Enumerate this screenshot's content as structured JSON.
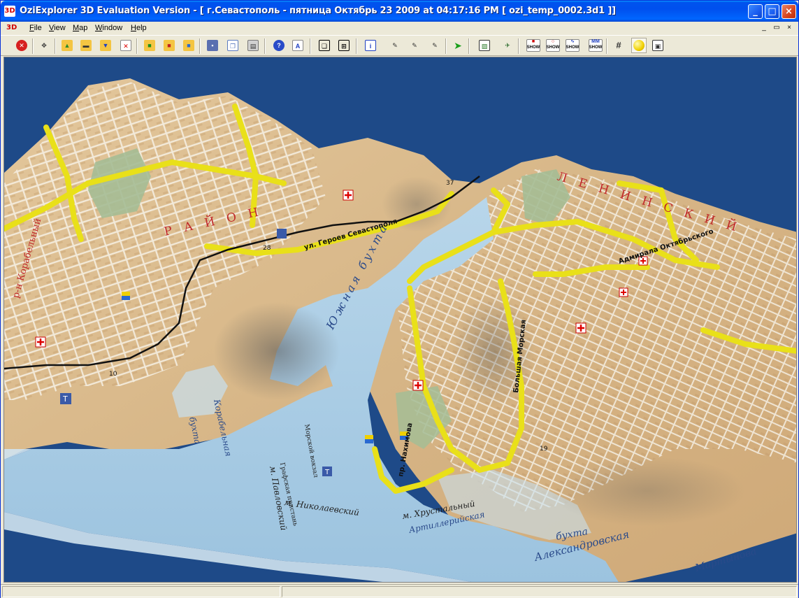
{
  "window": {
    "title": "OziExplorer 3D Evaluation Version - [ г.Севастополь - пятница Октябрь 23 2009  at  04:17:16 PM  [ ozi_temp_0002.3d1 ]]",
    "app_icon": "3D",
    "min_glyph": "_",
    "max_glyph": "□",
    "close_glyph": "×"
  },
  "menu": {
    "mdi_icon": "3D",
    "items": [
      {
        "label": "File",
        "accel": "F",
        "rest": "ile"
      },
      {
        "label": "View",
        "accel": "V",
        "rest": "iew"
      },
      {
        "label": "Map",
        "accel": "M",
        "rest": "ap"
      },
      {
        "label": "Window",
        "accel": "W",
        "rest": "indow"
      },
      {
        "label": "Help",
        "accel": "H",
        "rest": "elp"
      }
    ],
    "mdi_min": "_",
    "mdi_restore": "▭",
    "mdi_close": "×"
  },
  "toolbar": {
    "show_label": "SHOW",
    "mm_label": "MM"
  },
  "colors": {
    "background": "#1e4a88",
    "sea": "#aacde6",
    "land": "#d9b98c",
    "road": "#f0e61e",
    "park": "#9eb88e"
  },
  "map_labels": {
    "bay_south": "бухта",
    "bay_name": "Корабельная",
    "pavlovsky": "м. Павловский",
    "nikolaevsky": "м. Николаевский",
    "khrustalny": "м. Хрустальный",
    "bay_alexandrovskaya": "Александровская",
    "bay_artillery": "Артиллерийская",
    "bay_martynova": "Мартынова",
    "bay_text": "бухта",
    "marine_station": "Морской вокзал",
    "grafskaya": "Графская пристань",
    "north_bay": "Южная бухта",
    "district_left": "р-н Корабельный",
    "district_text": "Р А Й О Н",
    "district_right": "Л Е Н И Н С К И Й",
    "street_admiral": "Адмирала Октябрьского",
    "street_heroes": "ул. Героев Севастополя",
    "street_bolshaya": "Большая Морская",
    "street_nakhimov": "пр. Нахимова",
    "num_10": "10",
    "num_28": "28",
    "num_37": "37",
    "num_19": "19"
  }
}
